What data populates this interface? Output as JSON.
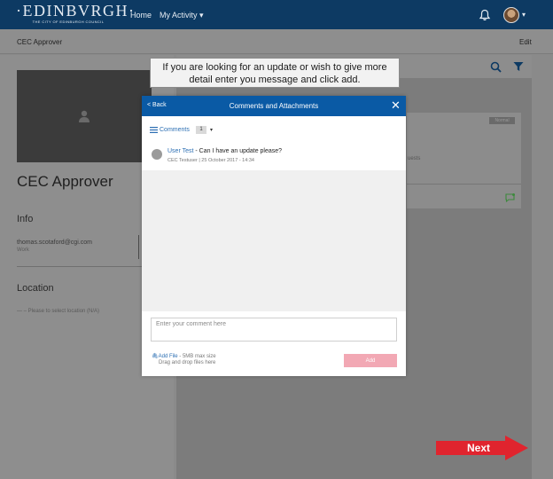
{
  "topnav": {
    "logo_text": "·EDINBVRGH·",
    "logo_sub": "THE CITY OF EDINBURGH COUNCIL",
    "home_label": "Home",
    "activity_label": "My Activity",
    "activity_chevron": "▾",
    "avatar_chevron": "▾"
  },
  "subheader": {
    "title": "CEC Approver",
    "edit_label": "Edit"
  },
  "profile": {
    "name": "CEC Approver",
    "info_title": "Info",
    "email": "thomas.scotaford@cgi.com",
    "email_type": "Work",
    "location_title": "Location",
    "location_value": "— – Please to select location (N/A)"
  },
  "card": {
    "badge": "Normal",
    "text": "uests"
  },
  "tooltip": {
    "text": "If you are looking for an update or wish to give more detail enter you message and click add."
  },
  "modal": {
    "back_label": "< Back",
    "title": "Comments and Attachments",
    "close_label": "✕",
    "comments_label": "Comments",
    "comments_count": "1",
    "count_chevron": "▾",
    "comment": {
      "author": "User Test",
      "body": " - Can I have an update please?",
      "meta": "CEC Testuser | 25 October 2017 - 14:34"
    },
    "input_placeholder": "Enter your comment here",
    "add_file_label": "Add File",
    "add_file_limit": " - 5MB max size",
    "drag_drop": "Drag and drop files here",
    "add_button": "Add"
  },
  "next_button": {
    "label": "Next",
    "color": "#e0242e"
  },
  "colors": {
    "nav": "#0d3a63",
    "modal_header": "#0a5aa5",
    "link": "#2c6fb3",
    "add_button": "#f2a8b4"
  }
}
